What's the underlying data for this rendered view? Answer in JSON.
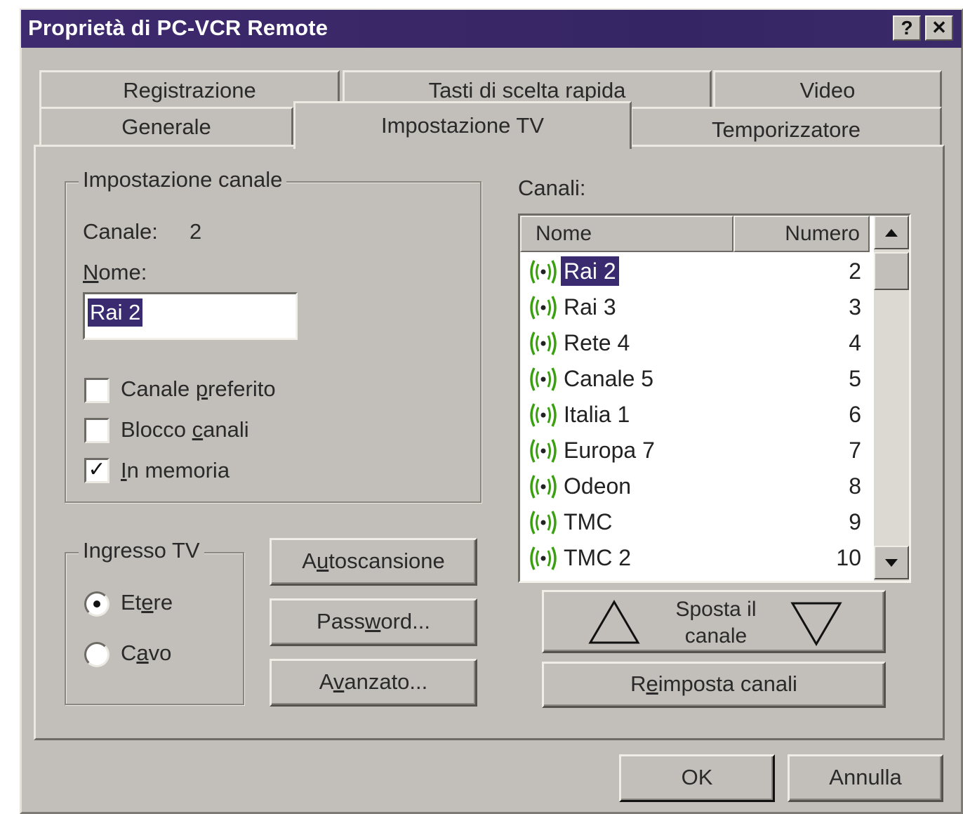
{
  "window": {
    "title": "Proprietà di PC-VCR Remote",
    "help_button": "?",
    "close_button": "✕"
  },
  "tabs": {
    "back_row": [
      "Registrazione",
      "Tasti di scelta rapida",
      "Video"
    ],
    "front_row": [
      "Generale",
      "Impostazione TV",
      "Temporizzatore"
    ],
    "active": "Impostazione TV"
  },
  "channel_setup": {
    "group_label": "Impostazione canale",
    "channel_label": "Canale:",
    "channel_value": "2",
    "name_label": "Nome:",
    "name_value": "Rai 2",
    "favorite_label": "Canale preferito",
    "favorite_checked": false,
    "lock_label": "Blocco canali",
    "lock_checked": false,
    "memory_label": "In memoria",
    "memory_checked": true,
    "check_mark": "✓"
  },
  "tv_input": {
    "group_label": "Ingresso TV",
    "options": [
      "Etere",
      "Cavo"
    ],
    "selected": "Etere"
  },
  "buttons": {
    "autoscan": "Autoscansione",
    "password": "Password...",
    "advanced": "Avanzato...",
    "move_channel": "Sposta il canale",
    "move_channel_line1": "Sposta il",
    "move_channel_line2": "canale",
    "reset_channels": "Reimposta canali",
    "ok": "OK",
    "cancel": "Annulla"
  },
  "channels": {
    "label": "Canali:",
    "column_name": "Nome",
    "column_number": "Numero",
    "selected": "Rai 2",
    "rows": [
      {
        "name": "Rai 2",
        "number": "2"
      },
      {
        "name": "Rai 3",
        "number": "3"
      },
      {
        "name": "Rete 4",
        "number": "4"
      },
      {
        "name": "Canale 5",
        "number": "5"
      },
      {
        "name": "Italia 1",
        "number": "6"
      },
      {
        "name": "Europa 7",
        "number": "7"
      },
      {
        "name": "Odeon",
        "number": "8"
      },
      {
        "name": "TMC",
        "number": "9"
      },
      {
        "name": "TMC 2",
        "number": "10"
      }
    ]
  },
  "icons": {
    "channel": "broadcast-icon",
    "move_up": "triangle-up-icon",
    "move_down": "triangle-down-icon",
    "scroll_up": "scroll-up-arrow-icon",
    "scroll_down": "scroll-down-arrow-icon"
  },
  "colors": {
    "titlebar": "#3a2868",
    "selection": "#3a2a70",
    "dialog_face": "#c2beb9",
    "broadcast_icon": "#3aa010"
  }
}
